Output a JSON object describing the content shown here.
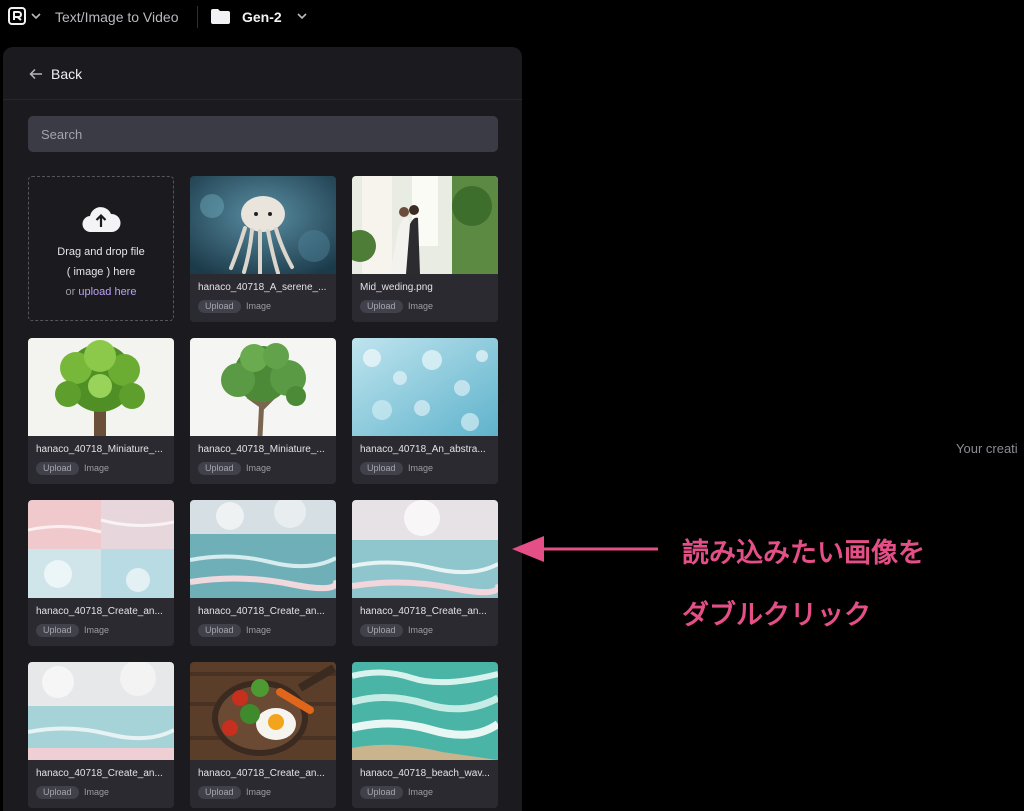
{
  "topbar": {
    "mode_label": "Text/Image to Video",
    "folder_label": "Gen-2"
  },
  "panel": {
    "back_label": "Back",
    "search_placeholder": "Search",
    "dropzone": {
      "line1": "Drag and drop file",
      "line2": "( image ) here",
      "line3_prefix": "or ",
      "line3_link": "upload here"
    },
    "cards": [
      {
        "name": "hanaco_40718_A_serene_...",
        "badge": "Upload",
        "type": "Image"
      },
      {
        "name": "Mid_weding.png",
        "badge": "Upload",
        "type": "Image"
      },
      {
        "name": "hanaco_40718_Miniature_...",
        "badge": "Upload",
        "type": "Image"
      },
      {
        "name": "hanaco_40718_Miniature_...",
        "badge": "Upload",
        "type": "Image"
      },
      {
        "name": "hanaco_40718_An_abstra...",
        "badge": "Upload",
        "type": "Image"
      },
      {
        "name": "hanaco_40718_Create_an...",
        "badge": "Upload",
        "type": "Image"
      },
      {
        "name": "hanaco_40718_Create_an...",
        "badge": "Upload",
        "type": "Image"
      },
      {
        "name": "hanaco_40718_Create_an...",
        "badge": "Upload",
        "type": "Image"
      },
      {
        "name": "hanaco_40718_Create_an...",
        "badge": "Upload",
        "type": "Image"
      },
      {
        "name": "hanaco_40718_Create_an...",
        "badge": "Upload",
        "type": "Image"
      },
      {
        "name": "hanaco_40718_beach_wav...",
        "badge": "Upload",
        "type": "Image"
      }
    ]
  },
  "main": {
    "empty_hint": "Your creati"
  },
  "annotation": {
    "line1": "読み込みたい画像を",
    "line2": "ダブルクリック",
    "color": "#e34f86"
  },
  "icons": [
    "logo-icon",
    "chevron-down-icon",
    "folder-icon",
    "arrow-left-icon",
    "cloud-upload-icon",
    "annotation-arrow-icon"
  ]
}
